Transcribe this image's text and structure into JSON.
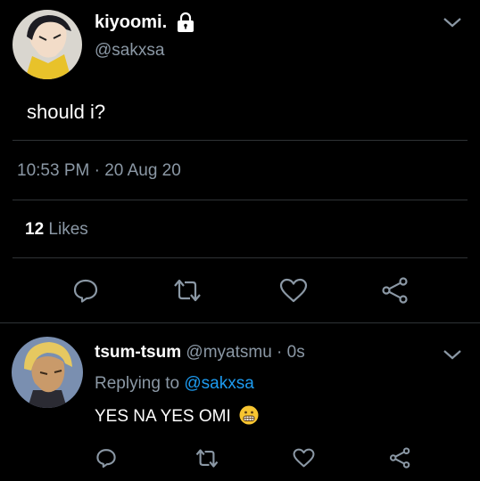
{
  "main_tweet": {
    "display_name": "kiyoomi.",
    "handle": "@sakxsa",
    "text": "should i?",
    "timestamp": "10:53 PM · 20 Aug 20",
    "likes_count": "12",
    "likes_label": "Likes",
    "avatar_icon": "avatar-anime-dark-hair",
    "lock_icon": "lock-icon"
  },
  "reply": {
    "display_name": "tsum-tsum",
    "handle": "@myatsmu",
    "time": "· 0s",
    "replying_prefix": "Replying to",
    "replying_handle": "@sakxsa",
    "text": "YES NA YES OMI",
    "emoji": "😬"
  },
  "colors": {
    "background": "#000000",
    "muted": "#8b98a5",
    "accent": "#1d9bf0",
    "divider": "#2f3336",
    "emoji_yellow": "#f7c531"
  }
}
